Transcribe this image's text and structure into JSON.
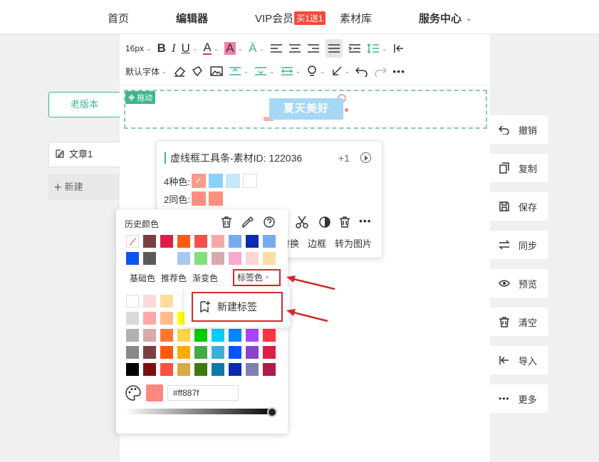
{
  "nav": {
    "home": "首页",
    "editor": "编辑器",
    "vip": "VIP会员",
    "vip_badge": "买1送1",
    "materials": "素材库",
    "service": "服务中心"
  },
  "sidebar": {
    "old_version": "老版本",
    "doc": "文章1",
    "new": "新建"
  },
  "toolbar": {
    "font_size": "16px",
    "font_family": "默认字体"
  },
  "canvas": {
    "drag_label": "拖动",
    "title_text": "夏天美好"
  },
  "material": {
    "title": "虚线框工具条-素材ID: 122036",
    "count": "+1",
    "four_colors_label": "4种色:",
    "two_colors_label": "2同色:",
    "four_colors": [
      "#ff9a8a",
      "#8dd0f7",
      "#c5e6fb",
      "#ffffff"
    ],
    "two_colors": [
      "#ff8f80",
      "#ff8f80"
    ],
    "ops": [
      "替换",
      "边框",
      "转为图片"
    ]
  },
  "color_picker": {
    "history_label": "历史颜色",
    "history_colors": [
      "none",
      "#7a3f3f",
      "#dc1f48",
      "#ff5a10",
      "#f7504a",
      "#f6a8a8",
      "#77aaf5",
      "#0a2ab3",
      "#77aaf5",
      "#0a55f0",
      "#5a5a5a",
      "",
      "#a9c6f7",
      "#82e07a",
      "#d9a9a9",
      "#f7aad1",
      "#ffd6d6",
      "#ffdca8"
    ],
    "tabs": [
      "基础色",
      "推荐色",
      "渐变色"
    ],
    "active_tab": "标签色",
    "grid_colors": [
      [
        "#ffffff",
        "#ffd8d8",
        "#ffdca0",
        "#ffffff",
        "#ffffff",
        "#ffffff",
        "#ffffff",
        "#ffffff",
        "#ffffff"
      ],
      [
        "#d9d9d9",
        "#ffa8a8",
        "#ffbb8a",
        "#ffff00",
        "#ffffff",
        "#ffffff",
        "#ffffff",
        "#ffffff",
        "#ffffff"
      ],
      [
        "#b0b0b0",
        "#d9a9a9",
        "#ff7733",
        "#ffd54a",
        "#00cc00",
        "#00ccff",
        "#0088ff",
        "#aa44ff",
        "#ff3344"
      ],
      [
        "#888888",
        "#7a3f3f",
        "#ff5a10",
        "#ffaa00",
        "#44aa44",
        "#3ab0d8",
        "#0055ff",
        "#8844cc",
        "#dc1f48"
      ],
      [
        "#000000",
        "#7a1010",
        "#ff5040",
        "#d9aa40",
        "#3c7a10",
        "#0a7aa8",
        "#0a2ab3",
        "#8080b0",
        "#b01c48"
      ]
    ],
    "current_color": "#ff887f",
    "hex_value": "#ff887f"
  },
  "tag_popup": {
    "new_tag": "新建标签"
  },
  "right_panel": {
    "items": [
      "撤销",
      "复制",
      "保存",
      "同步",
      "预览",
      "清空",
      "导入",
      "更多"
    ]
  }
}
